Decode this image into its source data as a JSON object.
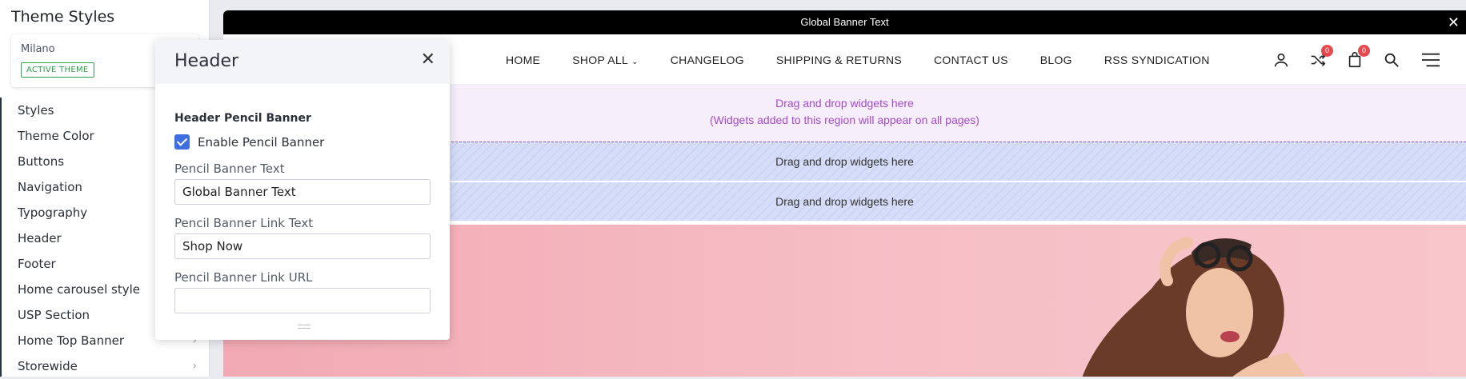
{
  "sidebar": {
    "title": "Theme Styles",
    "theme": {
      "name": "Milano",
      "badge": "ACTIVE THEME"
    },
    "items": [
      {
        "label": "Styles"
      },
      {
        "label": "Theme Color"
      },
      {
        "label": "Buttons"
      },
      {
        "label": "Navigation"
      },
      {
        "label": "Typography"
      },
      {
        "label": "Header"
      },
      {
        "label": "Footer"
      },
      {
        "label": "Home carousel style"
      },
      {
        "label": "USP Section"
      },
      {
        "label": "Home Top Banner"
      },
      {
        "label": "Storewide"
      }
    ]
  },
  "preview": {
    "global_banner": "Global Banner Text",
    "nav": [
      "HOME",
      "SHOP ALL",
      "CHANGELOG",
      "SHIPPING & RETURNS",
      "CONTACT US",
      "BLOG",
      "RSS SYNDICATION"
    ],
    "compare_count": "0",
    "cart_count": "0",
    "zone_global_line1": "Drag and drop widgets here",
    "zone_global_line2": "(Widgets added to this region will appear on all pages)",
    "zone2": "Drag and drop widgets here",
    "zone3": "Drag and drop widgets here"
  },
  "modal": {
    "title": "Header",
    "section_title": "Header Pencil Banner",
    "enable_label": "Enable Pencil Banner",
    "enable_checked": true,
    "fields": [
      {
        "label": "Pencil Banner Text",
        "value": "Global Banner Text"
      },
      {
        "label": "Pencil Banner Link Text",
        "value": "Shop Now"
      },
      {
        "label": "Pencil Banner Link URL",
        "value": ""
      }
    ]
  },
  "colors": {
    "checkbox": "#3e6ee0",
    "active_badge": "#2e9f4a",
    "global_zone": "#a44bc7",
    "badge": "#e5484d"
  }
}
